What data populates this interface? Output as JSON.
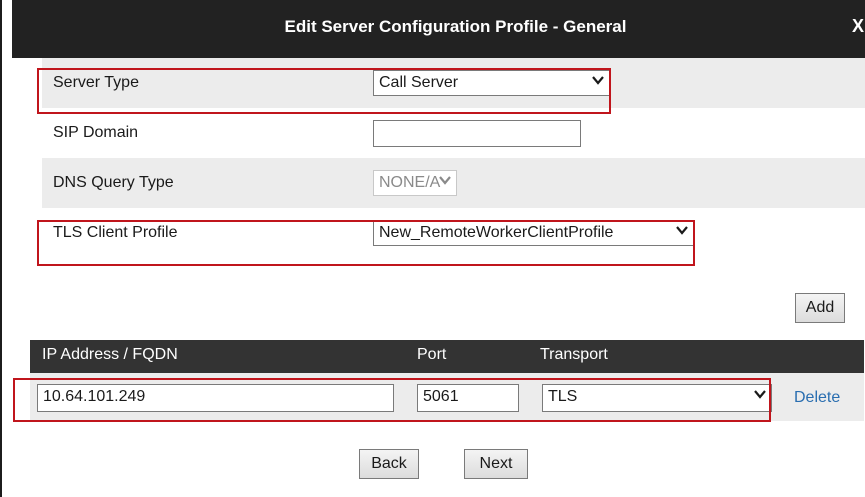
{
  "dialog": {
    "title": "Edit Server Configuration Profile - General",
    "close_label": "X"
  },
  "form": {
    "server_type": {
      "label": "Server Type",
      "value": "Call Server"
    },
    "sip_domain": {
      "label": "SIP Domain",
      "value": ""
    },
    "dns_query_type": {
      "label": "DNS Query Type",
      "value": "NONE/A",
      "disabled": true
    },
    "tls_client_profile": {
      "label": "TLS Client Profile",
      "value": "New_RemoteWorkerClientProfile"
    }
  },
  "buttons": {
    "add": "Add",
    "back": "Back",
    "next": "Next"
  },
  "table": {
    "headers": [
      "IP Address / FQDN",
      "Port",
      "Transport"
    ],
    "rows": [
      {
        "address": "10.64.101.249",
        "port": "5061",
        "transport": "TLS",
        "delete_label": "Delete"
      }
    ]
  },
  "colors": {
    "highlight": "#c0151c",
    "titlebar": "#222222",
    "link": "#2a6eb0"
  }
}
